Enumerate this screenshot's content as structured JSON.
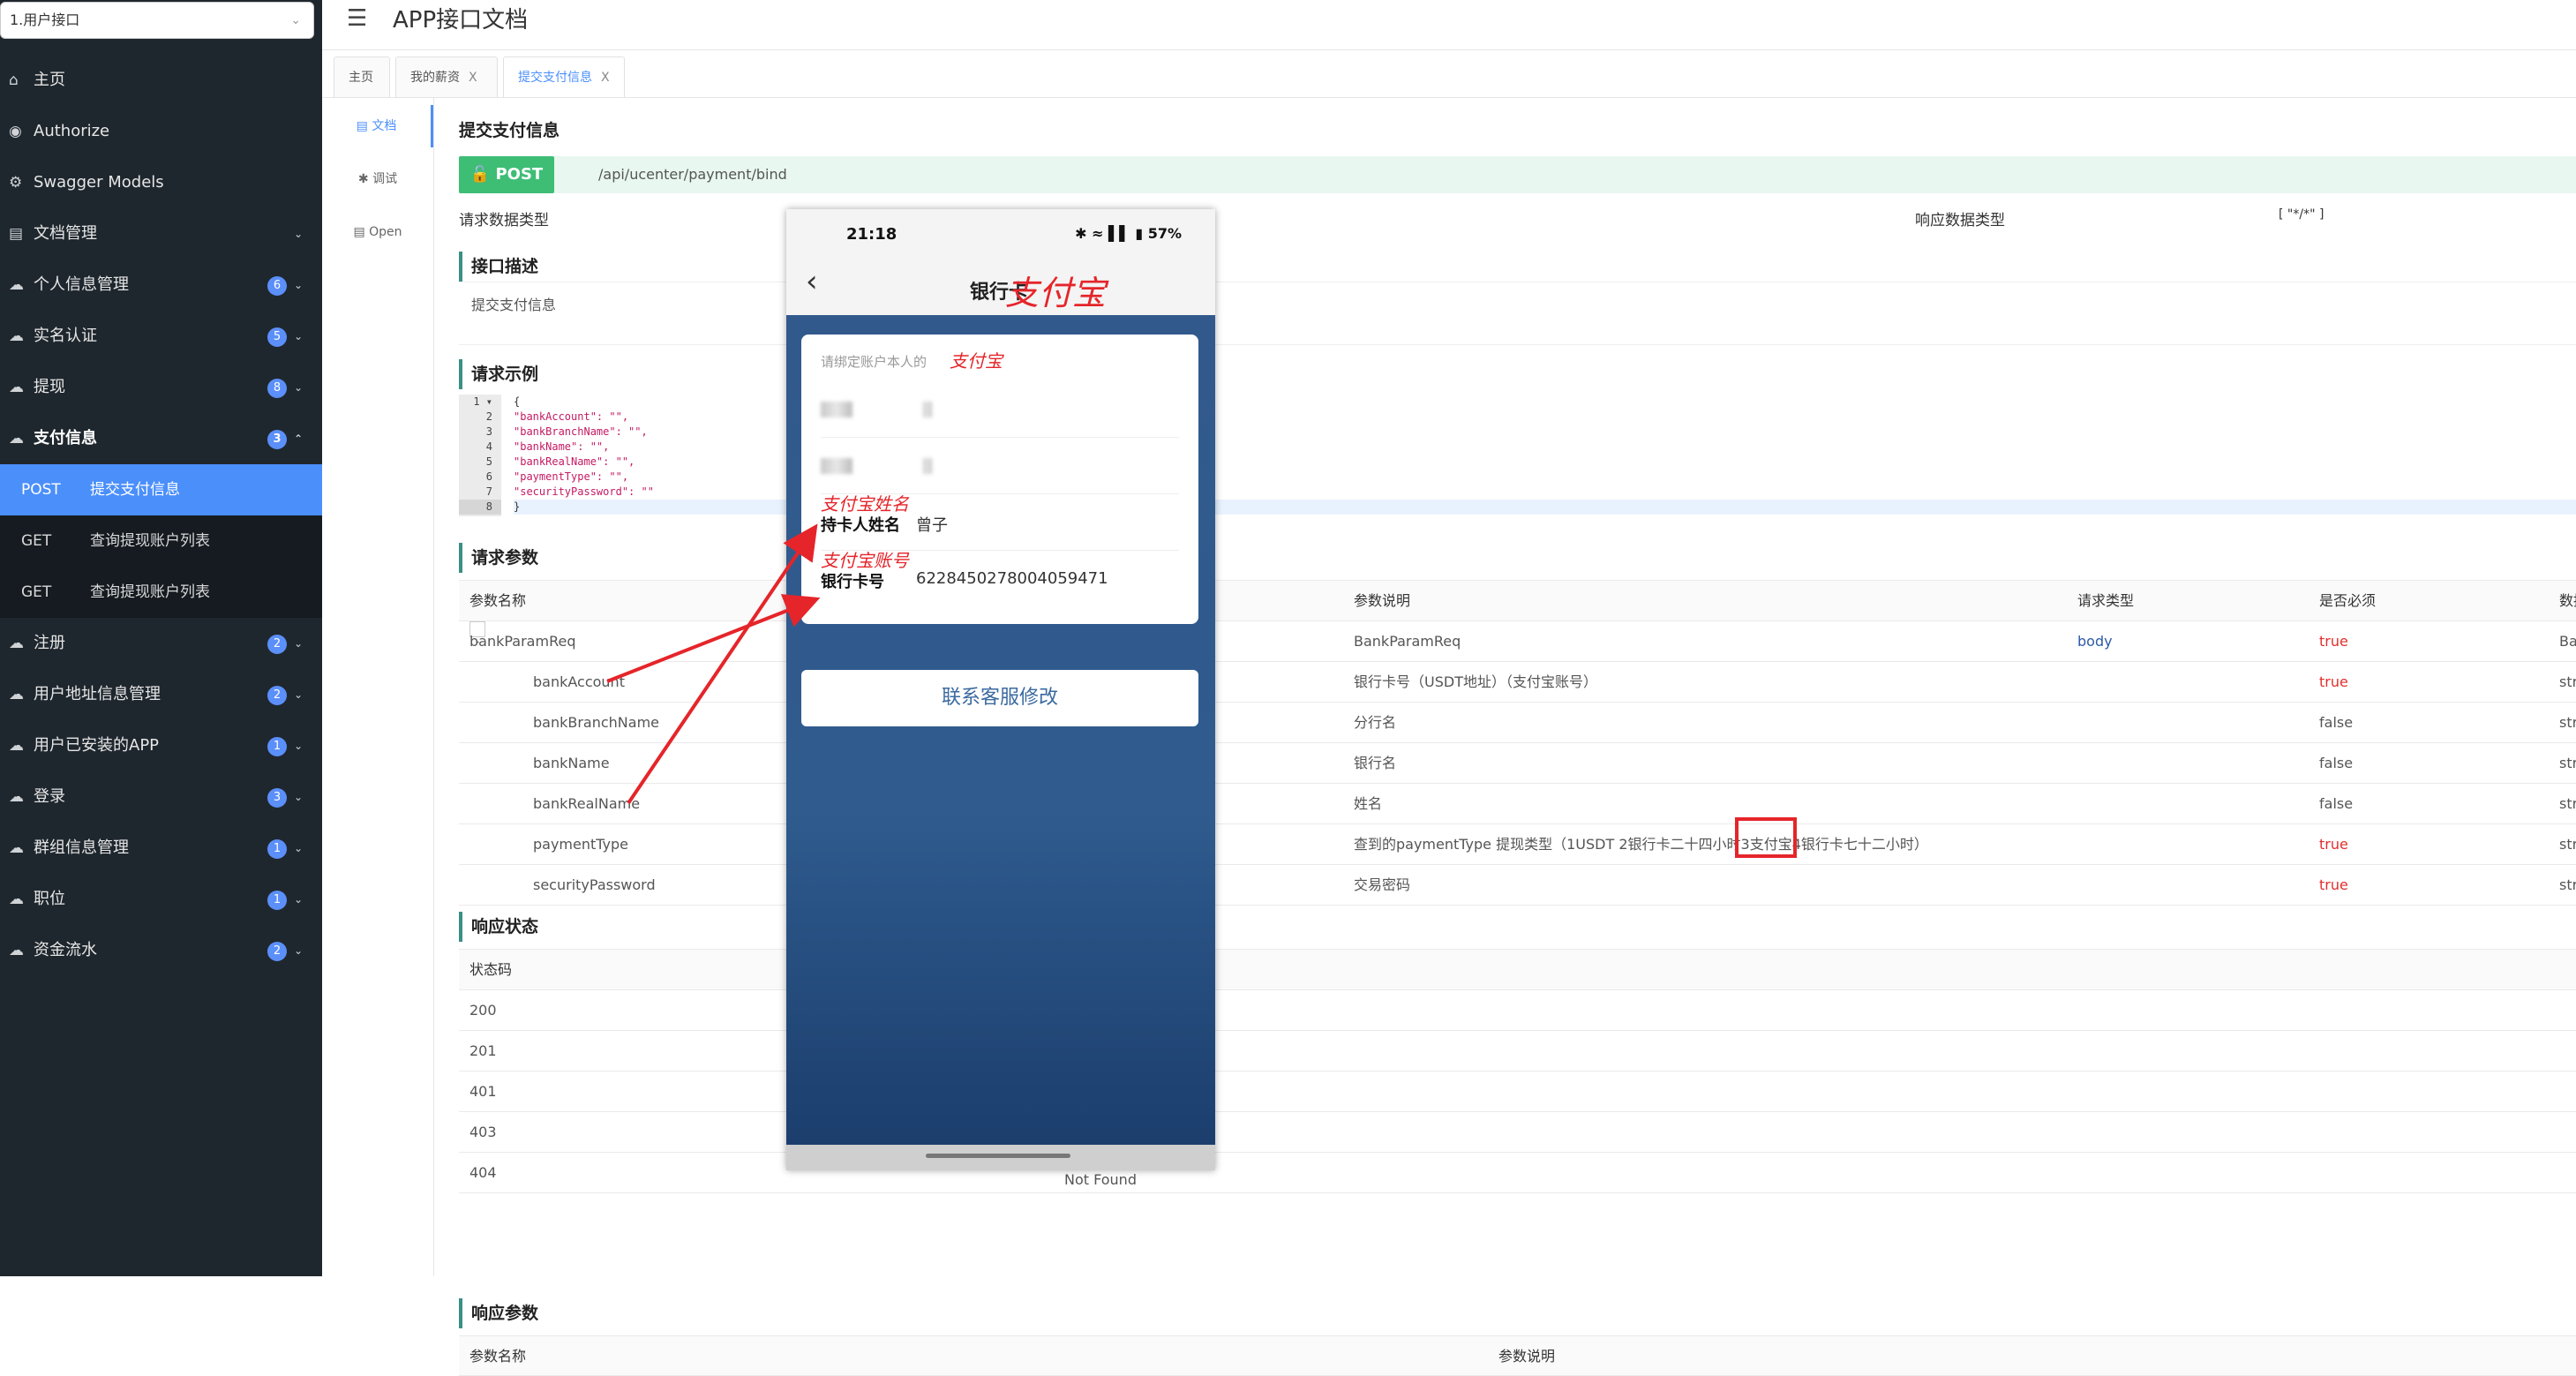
{
  "sidebar": {
    "selector": "1.用户接口",
    "items": [
      {
        "label": "主页",
        "icon": "home-icon",
        "badge": ""
      },
      {
        "label": "Authorize",
        "icon": "key-icon",
        "badge": ""
      },
      {
        "label": "Swagger Models",
        "icon": "gear-icon",
        "badge": ""
      },
      {
        "label": "文档管理",
        "icon": "doc-icon",
        "badge": ""
      },
      {
        "label": "个人信息管理",
        "icon": "cloud-icon",
        "badge": "6"
      },
      {
        "label": "实名认证",
        "icon": "cloud-icon",
        "badge": "5"
      },
      {
        "label": "提现",
        "icon": "cloud-icon",
        "badge": "8"
      },
      {
        "label": "支付信息",
        "icon": "cloud-icon",
        "badge": "3"
      }
    ],
    "sub_items": [
      {
        "method": "POST",
        "label": "提交支付信息"
      },
      {
        "method": "GET",
        "label": "查询提现账户列表"
      },
      {
        "method": "GET",
        "label": "查询提现账户列表"
      }
    ],
    "items_after": [
      {
        "label": "注册",
        "badge": "2"
      },
      {
        "label": "用户地址信息管理",
        "badge": "2"
      },
      {
        "label": "用户已安装的APP",
        "badge": "1"
      },
      {
        "label": "登录",
        "badge": "3"
      },
      {
        "label": "群组信息管理",
        "badge": "1"
      },
      {
        "label": "职位",
        "badge": "1"
      },
      {
        "label": "资金流水",
        "badge": "2"
      }
    ]
  },
  "header": {
    "title": "APP接口文档"
  },
  "tabs": [
    {
      "label": "主页",
      "close": ""
    },
    {
      "label": "我的薪资",
      "close": "X"
    },
    {
      "label": "提交支付信息",
      "close": "X"
    }
  ],
  "subnav": [
    "文档",
    "调试",
    "Open"
  ],
  "api": {
    "title": "提交支付信息",
    "method": "POST",
    "path": "/api/ucenter/payment/bind",
    "req_type_label": "请求数据类型",
    "resp_type_label": "响应数据类型",
    "resp_type_value": "[ \"*/*\" ]",
    "desc_title": "接口描述",
    "desc": "提交支付信息",
    "example_title": "请求示例",
    "code_lines": [
      "{",
      "  \"bankAccount\": \"\",",
      "  \"bankBranchName\": \"\",",
      "  \"bankName\": \"\",",
      "  \"bankRealName\": \"\",",
      "  \"paymentType\": \"\",",
      "  \"securityPassword\": \"\"",
      "}"
    ],
    "params_title": "请求参数",
    "params_headers": [
      "参数名称",
      "参数说明",
      "请求类型",
      "是否必须",
      "数据"
    ],
    "params": [
      {
        "name": "bankParamReq",
        "desc": "BankParamReq",
        "type": "body",
        "required": "true",
        "data": "Ban"
      },
      {
        "name": "bankAccount",
        "desc": "银行卡号（USDT地址）（支付宝账号）",
        "type": "",
        "required": "true",
        "data": "strin"
      },
      {
        "name": "bankBranchName",
        "desc": "分行名",
        "type": "",
        "required": "false",
        "data": "strin"
      },
      {
        "name": "bankName",
        "desc": "银行名",
        "type": "",
        "required": "false",
        "data": "strin"
      },
      {
        "name": "bankRealName",
        "desc": "姓名",
        "type": "",
        "required": "false",
        "data": "strin"
      },
      {
        "name": "paymentType",
        "desc": "查到的paymentType 提现类型（1USDT 2银行卡二十四小时3支付宝4银行卡七十二小时）",
        "type": "",
        "required": "true",
        "data": "strin"
      },
      {
        "name": "securityPassword",
        "desc": "交易密码",
        "type": "",
        "required": "true",
        "data": "strin"
      }
    ],
    "status_title": "响应状态",
    "status_header": "状态码",
    "status_codes": [
      "200",
      "201",
      "401",
      "403",
      "404"
    ],
    "status_404_desc": "Not Found",
    "resp_params_title": "响应参数",
    "resp_headers": [
      "参数名称",
      "参数说明"
    ]
  },
  "phone": {
    "time": "21:18",
    "battery": "57%",
    "nav_title": "银行卡",
    "nav_anno": "支付宝",
    "hint": "请绑定账户本人的",
    "hint_anno": "支付宝",
    "row3_anno": "支付宝姓名",
    "row3_label": "持卡人姓名",
    "row3_value": "曾子",
    "row4_anno": "支付宝账号",
    "row4_label": "银行卡号",
    "row4_value": "6228450278004059471",
    "contact": "联系客服修改"
  },
  "colors": {
    "accent": "#4b8ffb",
    "post": "#3ebd75",
    "annotation": "#e5252a",
    "sidebar": "#1f272e"
  }
}
